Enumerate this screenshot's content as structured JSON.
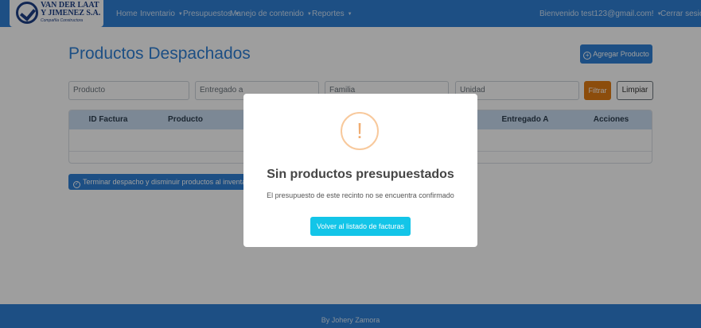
{
  "brand": {
    "line1": "VAN DER LAAT",
    "line2": "Y JIMENEZ S.A.",
    "subtitle": "Compañía Constructora"
  },
  "nav": {
    "items": [
      {
        "label": "Home"
      },
      {
        "label": "Inventario"
      },
      {
        "label": "Presupuestos"
      },
      {
        "label": "Manejo de contenido"
      },
      {
        "label": "Reportes"
      }
    ],
    "welcome": "Bienvenido test123@gmail.com!",
    "logout": "Cerrar sesión"
  },
  "page": {
    "title": "Productos Despachados",
    "add_button": "Agregar Producto"
  },
  "filters": {
    "producto_placeholder": "Producto",
    "entregado_placeholder": "Entregado a",
    "familia_placeholder": "Familia",
    "unidad_placeholder": "Unidad",
    "filter_button": "Filtrar",
    "clear_button": "Limpiar"
  },
  "table": {
    "headers": [
      "ID Factura",
      "Producto",
      "Entregado A",
      "Acciones"
    ]
  },
  "finish_button": "Terminar despacho y disminuir productos al inventario",
  "footer": {
    "text": "By Johery Zamora"
  },
  "modal": {
    "icon": "!",
    "title": "Sin productos presupuestados",
    "message": "El presupuesto de este recinto no se encuentra confirmado",
    "button": "Volver al listado de facturas"
  },
  "colors": {
    "primary": "#2f80d6",
    "warning": "#f8c99c",
    "info": "#13c5e8",
    "filter": "#e37d14"
  }
}
